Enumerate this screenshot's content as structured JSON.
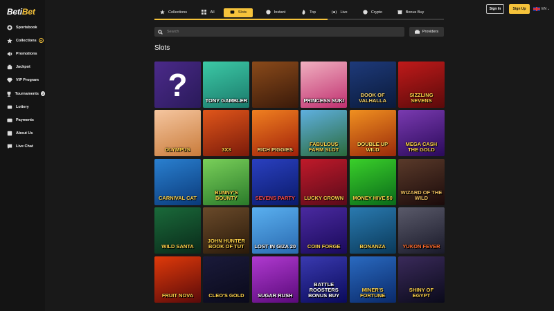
{
  "brand": {
    "logo_main": "Beti",
    "logo_accent": "Bet"
  },
  "sidebar": {
    "items": [
      {
        "label": "Sportsbook",
        "icon": "sportsbook-icon"
      },
      {
        "label": "Collections",
        "icon": "star-icon",
        "extra": "★"
      },
      {
        "label": "Promotions",
        "icon": "megaphone-icon"
      },
      {
        "label": "Jackpot",
        "icon": "jackpot-icon"
      },
      {
        "label": "VIP Program",
        "icon": "diamond-icon"
      },
      {
        "label": "Tournaments",
        "icon": "trophy-icon",
        "badge": "3"
      },
      {
        "label": "Lottery",
        "icon": "lottery-icon"
      },
      {
        "label": "Payments",
        "icon": "wallet-icon"
      },
      {
        "label": "About Us",
        "icon": "info-icon"
      },
      {
        "label": "Live Chat",
        "icon": "chat-icon"
      }
    ]
  },
  "header": {
    "sign_in": "Sign In",
    "sign_up": "Sign Up",
    "language": "EN",
    "language_caret": "⌄"
  },
  "tabs": [
    {
      "label": "Collections",
      "icon": "star-icon",
      "active": false
    },
    {
      "label": "All",
      "icon": "grid-icon",
      "active": false
    },
    {
      "label": "Slots",
      "icon": "slot-machine-icon",
      "active": true
    },
    {
      "label": "Instant",
      "icon": "instant-icon",
      "active": false
    },
    {
      "label": "Top",
      "icon": "flame-icon",
      "active": false
    },
    {
      "label": "Live",
      "icon": "live-icon",
      "active": false
    },
    {
      "label": "Crypto",
      "icon": "crypto-icon",
      "active": false
    },
    {
      "label": "Bonus Buy",
      "icon": "bonus-buy-icon",
      "active": false
    }
  ],
  "search": {
    "placeholder": "Search"
  },
  "providers_label": "Providers",
  "section_title": "Slots",
  "games": [
    {
      "title": "",
      "mystery": "?",
      "bg": "linear-gradient(135deg,#4b2a8a,#2a1a5a)",
      "color": "#ffffff"
    },
    {
      "title": "Tony Gambler",
      "bg": "linear-gradient(160deg,#3cc9a6,#1b7a6b)",
      "color": "#ffffff"
    },
    {
      "title": "",
      "bg": "linear-gradient(160deg,#8a4a1a,#3a1a0a)",
      "color": "#f6c33b"
    },
    {
      "title": "Princess Suki",
      "bg": "linear-gradient(160deg,#f0b0c0,#c03070)",
      "color": "#ffffff"
    },
    {
      "title": "Book of Valhalla",
      "bg": "linear-gradient(160deg,#1e3a7a,#0a1a3a)",
      "color": "#f6d36b"
    },
    {
      "title": "Sizzling Sevens",
      "bg": "linear-gradient(160deg,#c01a1a,#5a0a0a)",
      "color": "#ffd34a"
    },
    {
      "title": "Olympus",
      "bg": "linear-gradient(160deg,#f5c6a0,#c97b3a)",
      "color": "#ffd34a"
    },
    {
      "title": "3x3",
      "bg": "linear-gradient(160deg,#e0561a,#7a1a0a)",
      "color": "#ffd34a"
    },
    {
      "title": "Rich Piggies",
      "bg": "linear-gradient(160deg,#f08020,#a0200a)",
      "color": "#ffe080"
    },
    {
      "title": "Fabulous Farm Slot",
      "bg": "linear-gradient(160deg,#5fb0e0,#2a6a3a)",
      "color": "#ffd34a"
    },
    {
      "title": "Double Up Wild",
      "bg": "linear-gradient(160deg,#f09020,#9a2a0a)",
      "color": "#ffe060"
    },
    {
      "title": "Mega Cash the Gold",
      "bg": "linear-gradient(160deg,#7a3ab0,#2a0a5a)",
      "color": "#ffd34a"
    },
    {
      "title": "Carnival Cat",
      "bg": "linear-gradient(160deg,#2a80d0,#0a3a7a)",
      "color": "#ffd34a"
    },
    {
      "title": "Bunny's Bounty",
      "bg": "linear-gradient(160deg,#7ad05a,#2a7a2a)",
      "color": "#ffd34a"
    },
    {
      "title": "Sevens Party",
      "bg": "linear-gradient(160deg,#2a40c0,#0a1a6a)",
      "color": "#ff4a4a"
    },
    {
      "title": "Lucky Crown",
      "bg": "linear-gradient(160deg,#c01a2a,#5a0a1a)",
      "color": "#ffd34a"
    },
    {
      "title": "Money Hive 50",
      "bg": "linear-gradient(160deg,#3ad02a,#0a6a1a)",
      "color": "#ffd34a"
    },
    {
      "title": "Wizard of the Wild",
      "bg": "linear-gradient(160deg,#5a3a2a,#1a0a0a)",
      "color": "#f0c060"
    },
    {
      "title": "Wild Santa",
      "bg": "linear-gradient(160deg,#1a6a3a,#0a2a1a)",
      "color": "#ffd34a"
    },
    {
      "title": "John Hunter Book of Tut",
      "bg": "linear-gradient(160deg,#6a4a2a,#2a1a0a)",
      "color": "#ffd34a"
    },
    {
      "title": "Lost in Giza 20",
      "bg": "linear-gradient(160deg,#5ab0f0,#2a6ab0)",
      "color": "#ffffff"
    },
    {
      "title": "Coin Forge",
      "bg": "linear-gradient(160deg,#4a2aa0,#1a0a5a)",
      "color": "#ffd34a"
    },
    {
      "title": "Bonanza",
      "bg": "linear-gradient(160deg,#2a7ab0,#0a3a5a)",
      "color": "#ffd34a"
    },
    {
      "title": "Yukon Fever",
      "bg": "linear-gradient(160deg,#5a5a6a,#1a1a2a)",
      "color": "#ff6a2a"
    },
    {
      "title": "Fruit Nova",
      "bg": "linear-gradient(160deg,#e03a0a,#5a0a0a)",
      "color": "#ffd34a"
    },
    {
      "title": "Cleo's Gold",
      "bg": "linear-gradient(160deg,#1a1a3a,#0a0a1a)",
      "color": "#ffd34a"
    },
    {
      "title": "Sugar Rush",
      "bg": "linear-gradient(160deg,#b03ad0,#5a0a7a)",
      "color": "#ffffff"
    },
    {
      "title": "Battle Roosters Bonus Buy",
      "bg": "linear-gradient(160deg,#3a3ab0,#0a0a5a)",
      "color": "#ffffff"
    },
    {
      "title": "Miner's Fortune",
      "bg": "linear-gradient(160deg,#2a6ac0,#0a2a6a)",
      "color": "#ffd34a"
    },
    {
      "title": "Shiny of Egypt",
      "bg": "linear-gradient(160deg,#3a2a5a,#0a0a1a)",
      "color": "#ffd34a"
    }
  ],
  "colors": {
    "accent": "#f6c33b",
    "background": "#191919",
    "sidebar": "#141414"
  }
}
